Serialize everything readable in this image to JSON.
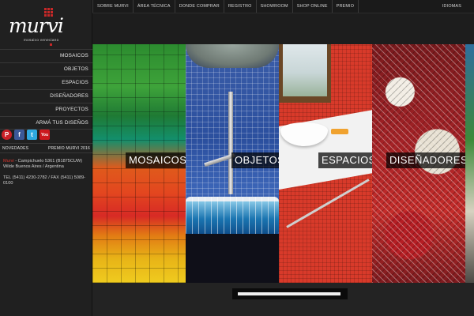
{
  "brand": {
    "name": "murvi",
    "tagline": "mosaico veneciano",
    "accent_color": "#c62828"
  },
  "topnav": {
    "items": [
      {
        "label": "SOBRE MURVI"
      },
      {
        "label": "ÁREA TÉCNICA"
      },
      {
        "label": "DONDE COMPRAR"
      },
      {
        "label": "REGISTRO"
      },
      {
        "label": "SHOWROOM"
      },
      {
        "label": "SHOP ONLINE"
      },
      {
        "label": "PREMIO"
      }
    ],
    "language_label": "IDIOMAS"
  },
  "sidebar": {
    "items": [
      {
        "label": "MOSAICOS"
      },
      {
        "label": "OBJETOS"
      },
      {
        "label": "ESPACIOS"
      },
      {
        "label": "DISEÑADORES"
      },
      {
        "label": "PROYECTOS"
      },
      {
        "label": "ARMÁ TUS DISEÑOS"
      }
    ],
    "social": [
      {
        "icon": "pinterest-icon",
        "glyph": "P"
      },
      {
        "icon": "facebook-icon",
        "glyph": "f"
      },
      {
        "icon": "twitter-icon",
        "glyph": "t"
      },
      {
        "icon": "youtube-icon",
        "glyph": "You"
      }
    ],
    "news_left": "NOVEDADES",
    "news_right": "PREMIO MURVI 2016",
    "address": {
      "brand": "Murvi",
      "line1": " - Campichuelo 5361 (B1875CUW) Wilde Buenos Aires / Argentina",
      "line2": "TEL (5411) 4230-2782 / FAX (5411) 5089-0100"
    }
  },
  "tiles": [
    {
      "label": "MOSAICOS"
    },
    {
      "label": "OBJETOS"
    },
    {
      "label": "ESPACIOS"
    },
    {
      "label": "DISEÑADORES"
    }
  ]
}
